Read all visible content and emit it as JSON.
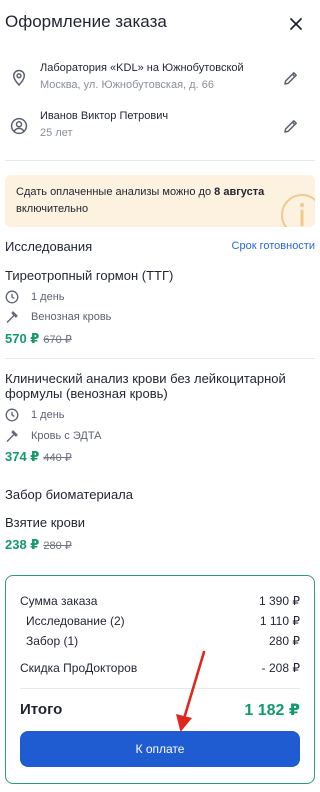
{
  "header": {
    "title": "Оформление заказа"
  },
  "clinic": {
    "name": "Лаборатория «KDL» на Южнобутовской",
    "address": "Москва, ул. Южнобутовская, д. 66"
  },
  "patient": {
    "name": "Иванов Виктор Петрович",
    "age": "25 лет"
  },
  "notice": {
    "text": "Сдать оплаченные анализы можно до ",
    "date": "8 августа",
    "suffix": " включительно"
  },
  "research": {
    "title": "Исследования",
    "ready_link": "Срок готовности",
    "items": [
      {
        "title": "Тиреотропный гормон (ТТГ)",
        "duration": "1 день",
        "material": "Венозная кровь",
        "price": "570 ₽",
        "old_price": "670 ₽"
      },
      {
        "title": "Клинический анализ крови без лейкоцитарной формулы (венозная кровь)",
        "duration": "1 день",
        "material": "Кровь с ЭДТА",
        "price": "374 ₽",
        "old_price": "440 ₽"
      }
    ]
  },
  "biomaterial": {
    "title": "Забор биоматериала",
    "service": "Взятие крови",
    "price": "238 ₽",
    "old_price": "280 ₽"
  },
  "summary": {
    "order_sum_label": "Сумма заказа",
    "order_sum": "1 390 ₽",
    "research_label": "Исследование (2)",
    "research_sum": "1 110 ₽",
    "sampling_label": "Забор (1)",
    "sampling_sum": "280 ₽",
    "discount_label": "Скидка ПроДокторов",
    "discount": "- 208 ₽",
    "total_label": "Итого",
    "total": "1 182 ₽",
    "pay_button": "К оплате"
  },
  "colors": {
    "accent": "#1f5cd1",
    "price": "#139a6a",
    "notice_bg": "#fdf1df",
    "arrow": "#e0271f"
  }
}
